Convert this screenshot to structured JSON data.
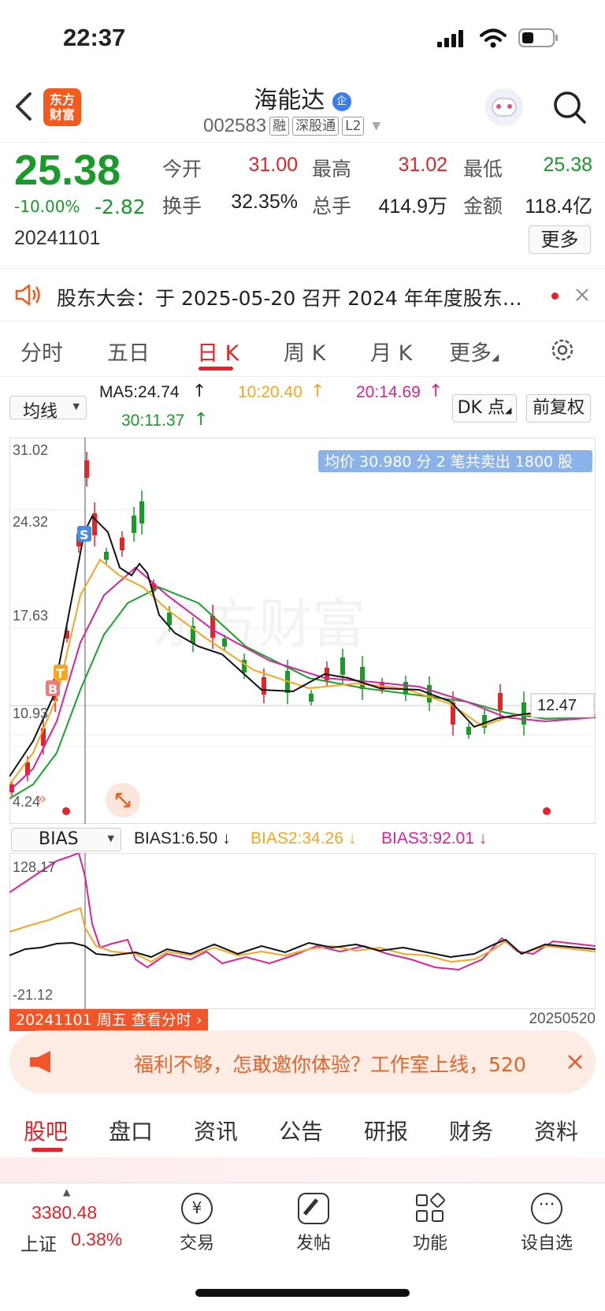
{
  "status_bar": {
    "time": "22:37"
  },
  "header": {
    "logo_text": "东方\n财富",
    "stock_name": "海能达",
    "stock_code": "002583",
    "tags": [
      "融",
      "深股通",
      "L2"
    ]
  },
  "quote": {
    "price": "25.38",
    "change_pct": "-10.00%",
    "change": "-2.82",
    "date": "20241101",
    "fields": [
      {
        "label": "今开",
        "value": "31.00",
        "color": "red"
      },
      {
        "label": "最高",
        "value": "31.02",
        "color": "red"
      },
      {
        "label": "最低",
        "value": "25.38",
        "color": "green"
      },
      {
        "label": "换手",
        "value": "32.35%",
        "color": "black"
      },
      {
        "label": "总手",
        "value": "414.9万",
        "color": "black"
      },
      {
        "label": "金额",
        "value": "118.4亿",
        "color": "black"
      }
    ],
    "more_label": "更多"
  },
  "notice": {
    "text": "股东大会：于 2025-05-20 召开 2024 年年度股东…"
  },
  "kline_tabs": [
    "分时",
    "五日",
    "日 K",
    "周 K",
    "月 K",
    "更多"
  ],
  "ma_row": {
    "selector": "均线",
    "ma5": "MA5:24.74",
    "ma10": "10:20.40",
    "ma20": "20:14.69",
    "ma30": "30:11.37",
    "dk_label": "DK 点",
    "fq_label": "前复权"
  },
  "kchart": {
    "y_labels": [
      "31.02",
      "24.32",
      "17.63",
      "10.93",
      "4.24"
    ],
    "tooltip": "均价 30.980 分 2 笔共卖出 1800 股",
    "current_value": "12.47",
    "markers": [
      "S",
      "T",
      "B"
    ]
  },
  "bias_row": {
    "selector": "BIAS",
    "bias1": "BIAS1:6.50",
    "bias2": "BIAS2:34.26",
    "bias3": "BIAS3:92.01",
    "y_top": "128.17",
    "y_bottom": "-21.12",
    "start_label": "20241101 周五 查看分时",
    "end_label": "20250520"
  },
  "promo": {
    "text": "福利不够，怎敢邀你体验？工作室上线，520"
  },
  "section_tabs": [
    "股吧",
    "盘口",
    "资讯",
    "公告",
    "研报",
    "财务",
    "资料"
  ],
  "bottom_bar": {
    "index_value": "3380.48",
    "index_name": "上证",
    "index_pct": "0.38%",
    "items": [
      "交易",
      "发帖",
      "功能",
      "设自选"
    ]
  },
  "colors": {
    "up": "#e0252b",
    "down": "#1a9a2a",
    "ma10": "#f5a623",
    "ma20": "#d6249f",
    "ma30": "#1aa32a"
  }
}
